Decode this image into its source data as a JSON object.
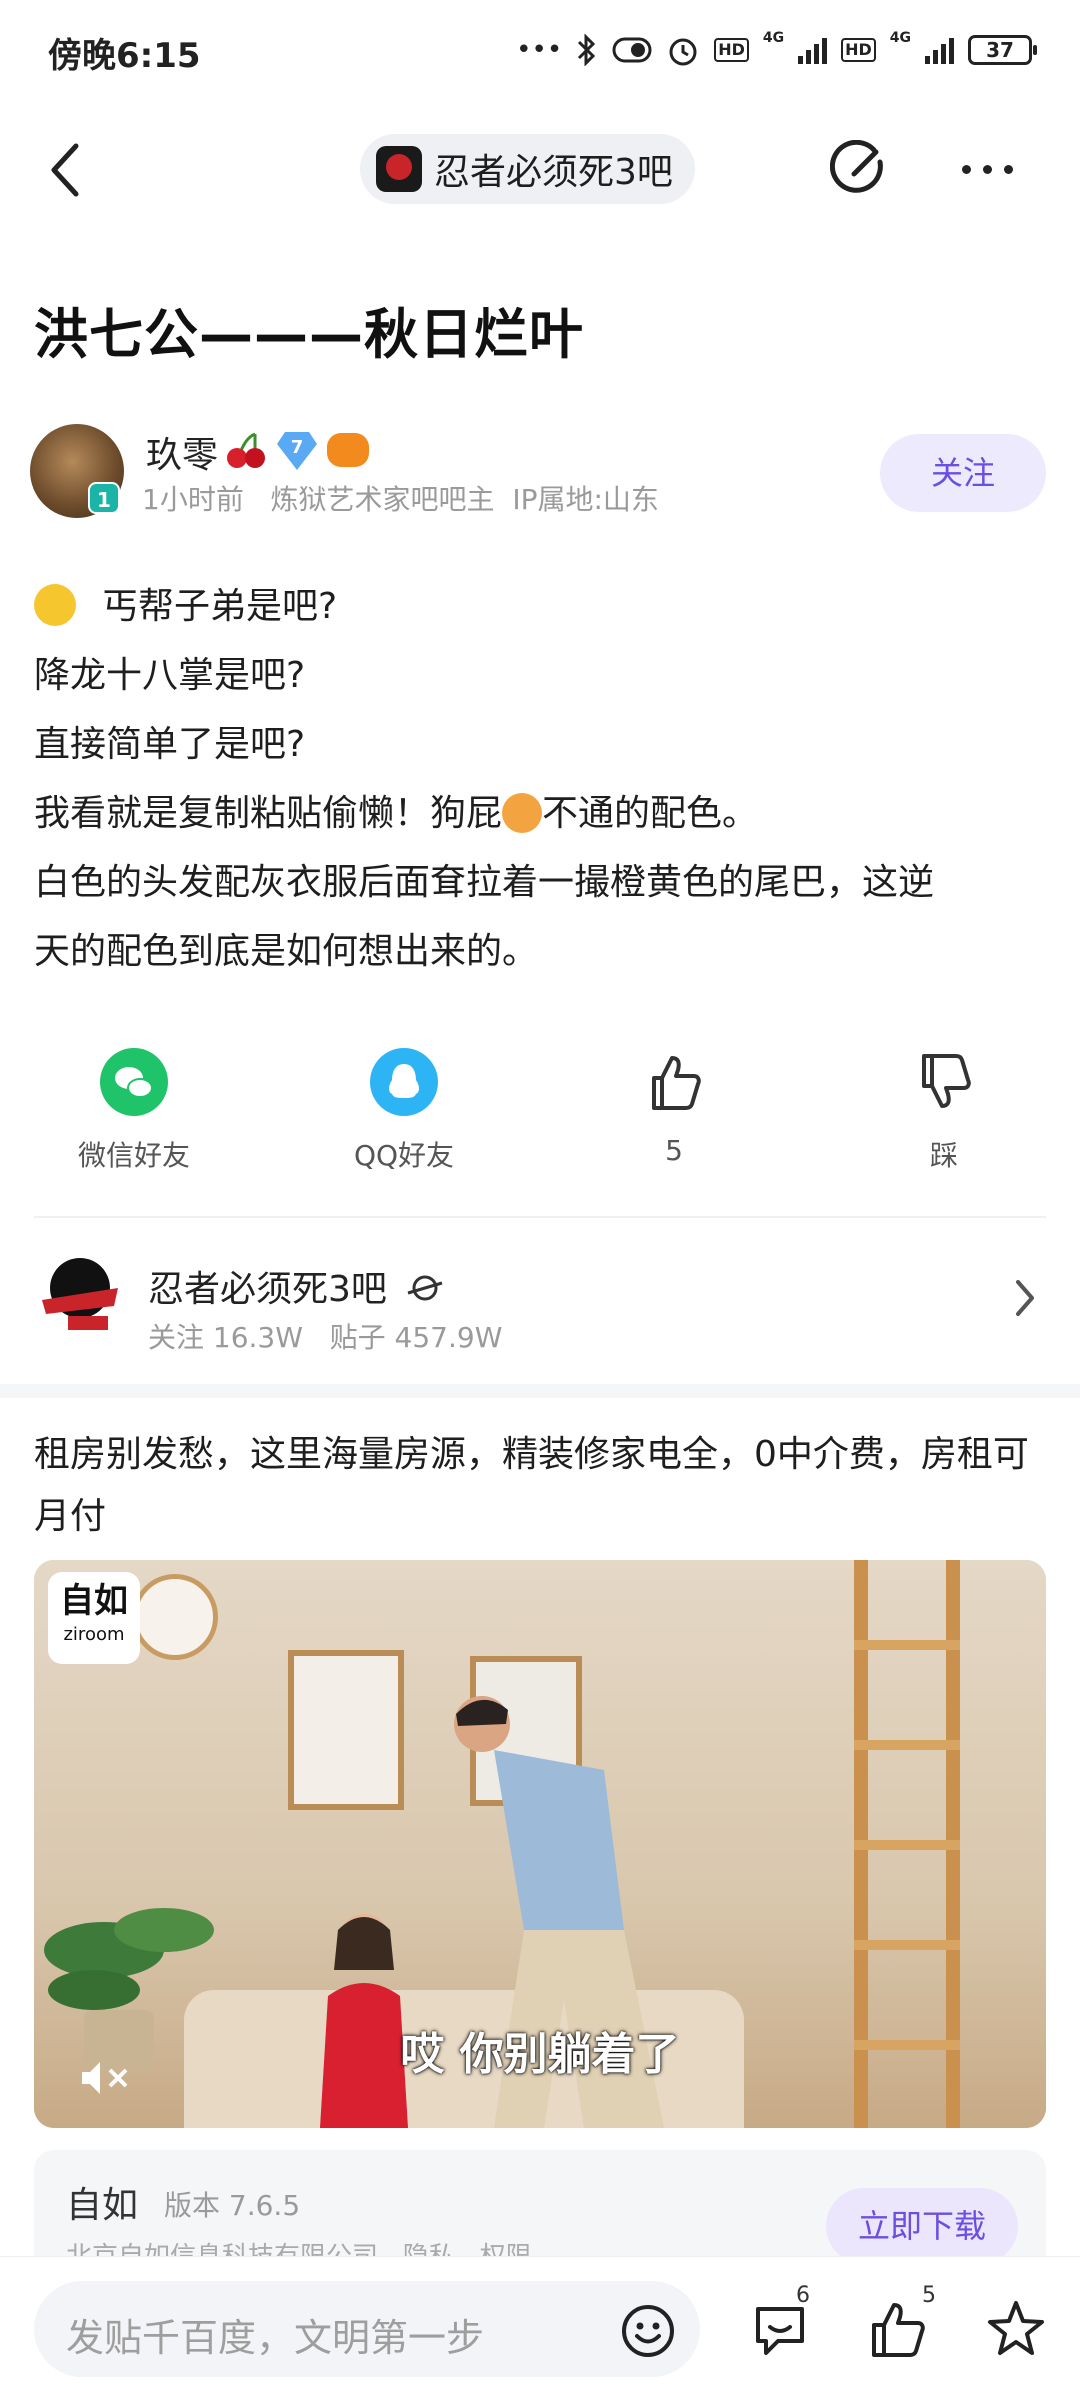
{
  "status_bar": {
    "time": "傍晚6:15",
    "dots": "•••",
    "network_1": "4G",
    "network_2": "4G",
    "hd_1": "HD",
    "hd_2": "HD",
    "battery": "37"
  },
  "nav": {
    "forum_name": "忍者必须死3吧"
  },
  "post": {
    "title": "洪七公———秋日烂叶",
    "author": {
      "name": "玖零",
      "level": "1",
      "diamond_level": "7",
      "meta": "1小时前   炼狱艺术家吧吧主  IP属地:山东"
    },
    "follow_label": "关注",
    "body": {
      "line1": "丐帮子弟是吧?",
      "line2": "降龙十八掌是吧?",
      "line3": "直接简单了是吧?",
      "line4_a": "我看就是复制粘贴偷懒！狗屁",
      "line4_b": "不通的配色。",
      "line5": "白色的头发配灰衣服后面耷拉着一撮橙黄色的尾巴，这逆",
      "line6": "天的配色到底是如何想出来的。"
    }
  },
  "share": {
    "wechat": "微信好友",
    "qq": "QQ好友",
    "likes": "5",
    "dislike": "踩"
  },
  "forum_card": {
    "name": "忍者必须死3吧",
    "meta": "关注 16.3W   贴子 457.9W"
  },
  "ad": {
    "title": "租房别发愁，这里海量房源，精装修家电全，0中介费，房租可月付",
    "logo_cn": "自如",
    "logo_en": "ziroom",
    "subtitle": "哎 你别躺着了",
    "app_name": "自如",
    "version": "版本 7.6.5",
    "company": "北京自如信息科技有限公司   隐私   权限",
    "download_label": "立即下载"
  },
  "bottom_bar": {
    "placeholder": "发贴千百度，文明第一步",
    "comment_count": "6",
    "like_count": "5"
  },
  "colors": {
    "accent": "#6b4fe0",
    "follow_bg": "#eeeafd",
    "wechat": "#1fc36a",
    "qq": "#2db4f5"
  },
  "icons": [
    "back-icon",
    "edit-icon",
    "more-icon",
    "wechat-icon",
    "qq-icon",
    "thumb-up-icon",
    "thumb-down-icon",
    "chevron-right-icon",
    "smile-icon",
    "comment-icon",
    "like-icon",
    "star-icon",
    "mute-icon"
  ]
}
